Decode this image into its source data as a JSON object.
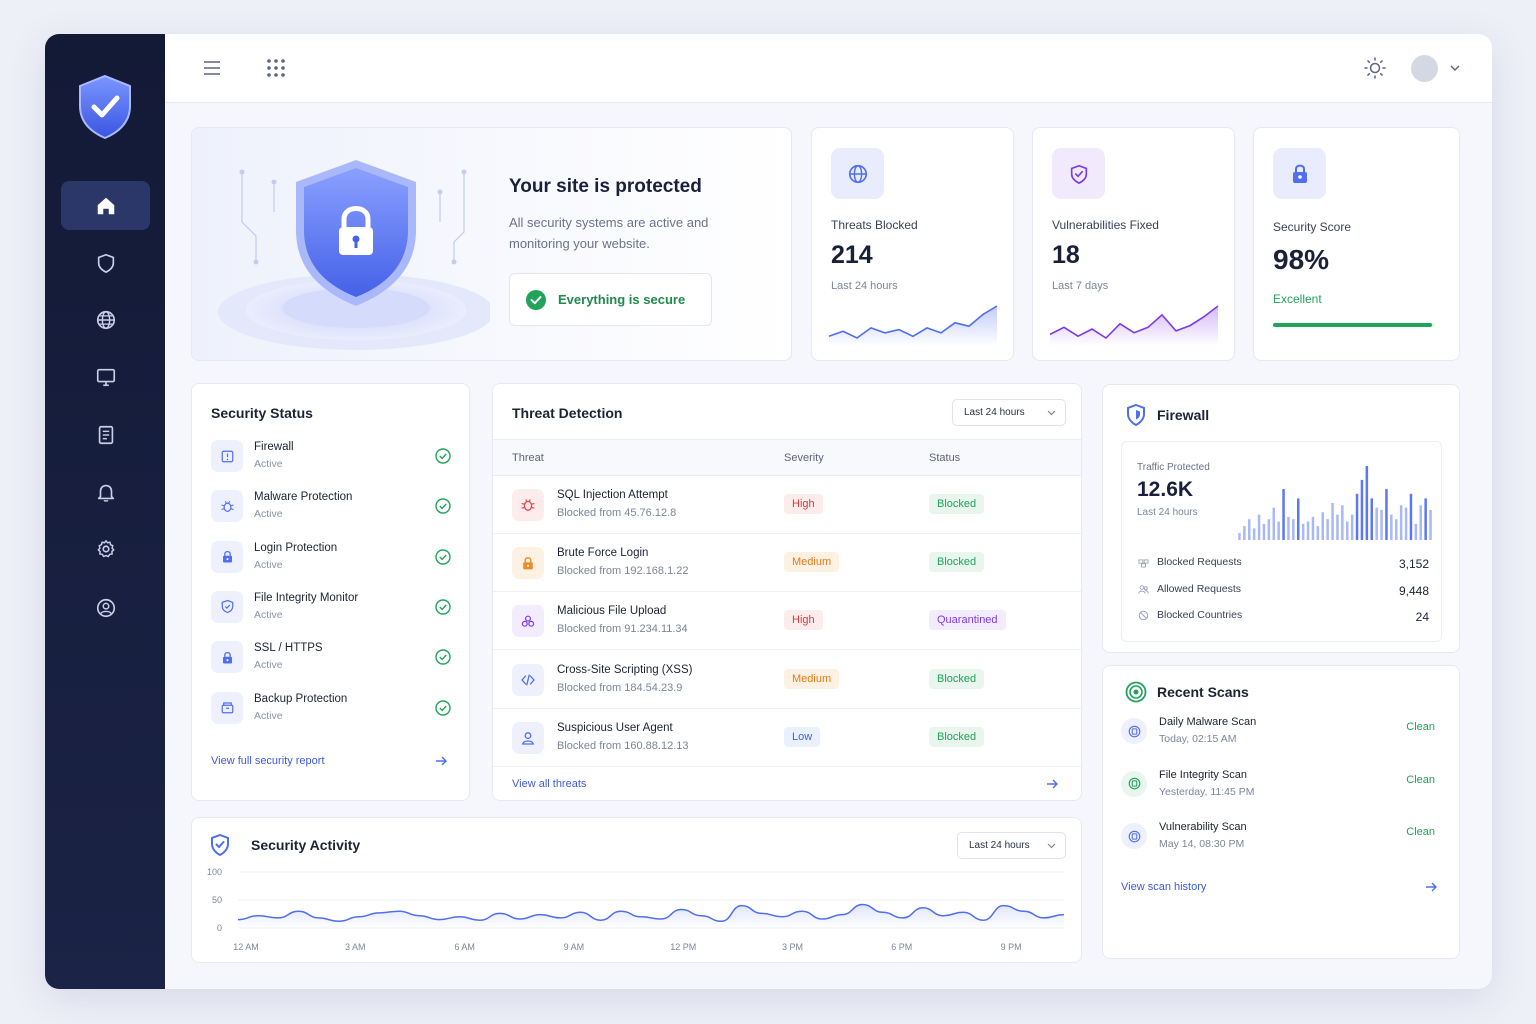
{
  "sidebar": {
    "items": [
      {
        "name": "home",
        "icon": "home-icon",
        "active": true
      },
      {
        "name": "shield",
        "icon": "shield-icon"
      },
      {
        "name": "globe",
        "icon": "globe-icon"
      },
      {
        "name": "monitor",
        "icon": "monitor-icon"
      },
      {
        "name": "document",
        "icon": "document-icon"
      },
      {
        "name": "bell",
        "icon": "bell-icon"
      },
      {
        "name": "settings",
        "icon": "gear-icon"
      },
      {
        "name": "profile",
        "icon": "user-circle-icon"
      }
    ]
  },
  "hero": {
    "title": "Your site is protected",
    "description_line1": "All security systems are active and",
    "description_line2": "monitoring your website.",
    "status": "Everything is secure"
  },
  "stats": {
    "threats": {
      "label": "Threats Blocked",
      "value": "214",
      "period": "Last 24 hours",
      "trend": [
        22,
        25,
        21,
        27,
        24,
        26,
        22,
        27,
        24,
        30,
        28,
        35,
        40
      ]
    },
    "vulns": {
      "label": "Vulnerabilities Fixed",
      "value": "18",
      "period": "Last 7 days",
      "trend": [
        20,
        24,
        19,
        23,
        18,
        26,
        21,
        24,
        31,
        22,
        25,
        30,
        36
      ]
    },
    "score": {
      "label": "Security Score",
      "value": "98%",
      "rating": "Excellent",
      "percent": 98
    }
  },
  "security_status": {
    "title": "Security Status",
    "items": [
      {
        "name": "Firewall",
        "status": "Active",
        "icon": "firewall-icon"
      },
      {
        "name": "Malware Protection",
        "status": "Active",
        "icon": "bug-icon"
      },
      {
        "name": "Login Protection",
        "status": "Active",
        "icon": "lock-icon"
      },
      {
        "name": "File Integrity Monitor",
        "status": "Active",
        "icon": "shield-check-icon"
      },
      {
        "name": "SSL / HTTPS",
        "status": "Active",
        "icon": "lock-icon"
      },
      {
        "name": "Backup Protection",
        "status": "Active",
        "icon": "archive-icon"
      }
    ],
    "link": "View full security report"
  },
  "threat_detection": {
    "title": "Threat Detection",
    "filter": "Last 24 hours",
    "columns": [
      "Threat",
      "Severity",
      "Status"
    ],
    "rows": [
      {
        "name": "SQL Injection Attempt",
        "source": "Blocked from 45.76.12.8",
        "severity": "High",
        "status": "Blocked",
        "icon": "bug-icon"
      },
      {
        "name": "Brute Force Login",
        "source": "Blocked from 192.168.1.22",
        "severity": "Medium",
        "status": "Blocked",
        "icon": "lock-icon"
      },
      {
        "name": "Malicious File Upload",
        "source": "Blocked from 91.234.11.34",
        "severity": "High",
        "status": "Quarantined",
        "icon": "biohazard-icon"
      },
      {
        "name": "Cross-Site Scripting (XSS)",
        "source": "Blocked from 184.54.23.9",
        "severity": "Medium",
        "status": "Blocked",
        "icon": "code-icon"
      },
      {
        "name": "Suspicious User Agent",
        "source": "Blocked from 160.88.12.13",
        "severity": "Low",
        "status": "Blocked",
        "icon": "user-icon"
      }
    ],
    "link": "View all threats"
  },
  "firewall": {
    "title": "Firewall",
    "traffic_label": "Traffic Protected",
    "traffic_value": "12.6K",
    "traffic_period": "Last 24 hours",
    "bars": [
      6,
      12,
      18,
      10,
      22,
      14,
      18,
      28,
      16,
      44,
      20,
      18,
      36,
      14,
      16,
      20,
      12,
      24,
      18,
      32,
      22,
      30,
      16,
      22,
      40,
      52,
      64,
      36,
      28,
      26,
      44,
      22,
      18,
      30,
      28,
      40,
      14,
      30,
      36,
      26
    ],
    "rows": [
      {
        "label": "Blocked Requests",
        "value": "3,152",
        "icon": "block-icon"
      },
      {
        "label": "Allowed Requests",
        "value": "9,448",
        "icon": "users-icon"
      },
      {
        "label": "Blocked Countries",
        "value": "24",
        "icon": "ban-icon"
      }
    ]
  },
  "recent_scans": {
    "title": "Recent Scans",
    "items": [
      {
        "name": "Daily Malware Scan",
        "time": "Today, 02:15 AM",
        "result": "Clean"
      },
      {
        "name": "File Integrity Scan",
        "time": "Yesterday, 11:45 PM",
        "result": "Clean"
      },
      {
        "name": "Vulnerability Scan",
        "time": "May 14, 08:30 PM",
        "result": "Clean"
      }
    ],
    "link": "View scan history"
  },
  "activity": {
    "title": "Security Activity",
    "filter": "Last 24 hours",
    "y_ticks": [
      "100",
      "50",
      "0"
    ],
    "x_ticks": [
      "12 AM",
      "3 AM",
      "6 AM",
      "9 AM",
      "12 PM",
      "3 PM",
      "6 PM",
      "9 PM"
    ],
    "values": [
      15,
      22,
      18,
      30,
      18,
      12,
      20,
      27,
      30,
      22,
      15,
      20,
      14,
      26,
      16,
      24,
      18,
      28,
      14,
      30,
      20,
      16,
      33,
      22,
      12,
      40,
      26,
      20,
      30,
      16,
      24,
      42,
      28,
      18,
      36,
      22,
      28,
      14,
      40,
      30,
      18,
      24
    ]
  },
  "colors": {
    "accent": "#4f6ef0",
    "success": "#22a35a",
    "danger": "#e5484d",
    "warning": "#f08a24",
    "purple": "#7c3aed"
  }
}
